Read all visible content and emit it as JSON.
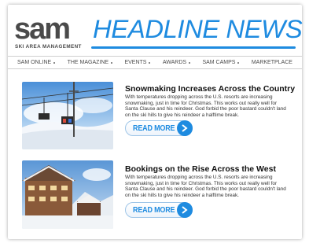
{
  "masthead": {
    "brand": "sam",
    "brand_sub": "SKI AREA MANAGEMENT",
    "headline": "HEADLINE NEWS"
  },
  "nav": {
    "items": [
      "SAM ONLINE",
      "THE MAGAZINE",
      "EVENTS",
      "AWARDS",
      "SAM CAMPS",
      "MARKETPLACE"
    ]
  },
  "articles": [
    {
      "title": "Snowmaking Increases Across the Country",
      "body": "With temperatures dropping across the U.S. resorts are increasing snowmaking, just in time for Christmas. This works out really well for Santa Clause and his reindeer. God forbid the poor bastard couldn't land on the ski hills to give his reindeer a halftime break.",
      "read_more": "READ MORE",
      "image": "ski-lift-photo"
    },
    {
      "title": "Bookings on the Rise Across the West",
      "body": "With temperatures dropping across the U.S. resorts are increasing snowmaking, just in time for Christmas. This works out really well for Santa Clause and his reindeer. God forbid the poor bastard couldn't land on the ski hills to give his reindeer a halftime break.",
      "read_more": "READ MORE",
      "image": "ski-lodge-photo"
    }
  ],
  "colors": {
    "accent": "#1e8be0",
    "brand_gray": "#4a4a4a"
  }
}
